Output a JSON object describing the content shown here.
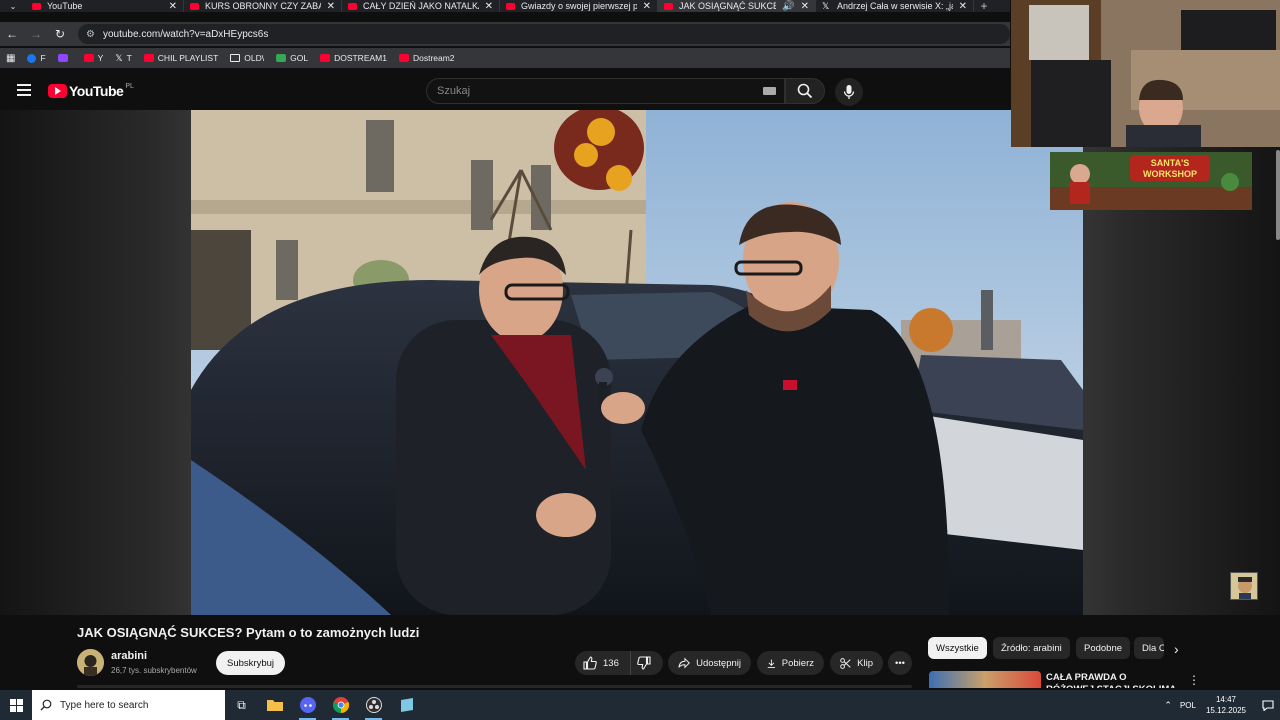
{
  "browser": {
    "tabs": [
      {
        "title": "YouTube",
        "icon": "youtube-icon"
      },
      {
        "title": "KURS OBRONNY CZY ZABAWA",
        "icon": "youtube-icon"
      },
      {
        "title": "CAŁY DZIEŃ JAKO NATALKA!! (I",
        "icon": "youtube-icon"
      },
      {
        "title": "Gwiazdy o swojej pierwszej pra",
        "icon": "youtube-icon"
      },
      {
        "title": "JAK OSIĄGNĄĆ SUKCES? Py",
        "icon": "youtube-icon",
        "active": true
      },
      {
        "title": "Andrzej Cała w serwisie X: „ja ju",
        "icon": "x-icon"
      }
    ],
    "url": "youtube.com/watch?v=aDxHEypcs6s",
    "bookmarks": [
      {
        "label": "F",
        "icon": "facebook-icon"
      },
      {
        "label": "",
        "icon": "twitch-icon"
      },
      {
        "label": "Y",
        "icon": "youtube-icon"
      },
      {
        "label": "T",
        "icon": "x-icon"
      },
      {
        "label": "CHIL PLAYLIST",
        "icon": "youtube-icon"
      },
      {
        "label": "OLD\\",
        "icon": "folder-icon"
      },
      {
        "label": "GOL",
        "icon": "gol-icon"
      },
      {
        "label": "DOSTREAM1",
        "icon": "youtube-icon"
      },
      {
        "label": "Dostream2",
        "icon": "youtube-icon"
      }
    ]
  },
  "youtube": {
    "logo_text": "YouTube",
    "country": "PL",
    "search_placeholder": "Szukaj"
  },
  "video": {
    "title": "JAK OSIĄGNĄĆ SUKCES? Pytam o to zamożnych ludzi",
    "channel": "arabini",
    "subscribers": "26,7 tys. subskrybentów",
    "subscribe_label": "Subskrybuj",
    "likes": "136",
    "share_label": "Udostępnij",
    "download_label": "Pobierz",
    "clip_label": "Klip"
  },
  "sidebar": {
    "chips": [
      "Wszystkie",
      "Źródło: arabini",
      "Podobne",
      "Dla C"
    ],
    "active_chip": "Wszystkie",
    "recommendation_title": "CAŁA PRAWDA O RÓŻOWEJ STACJI SKOLIMA -"
  },
  "overlay": {
    "banner_text": "SANTA'S WORKSHOP"
  },
  "taskbar": {
    "search_placeholder": "Type here to search",
    "language": "POL",
    "time": "14:47",
    "date": "15.12.2025"
  },
  "colors": {
    "brand_red": "#ff0033",
    "page_bg": "#0f0f0f",
    "chip_bg": "#272727"
  }
}
